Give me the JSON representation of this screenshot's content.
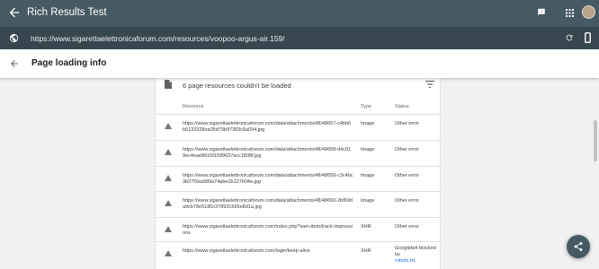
{
  "app": {
    "title": "Rich Results Test"
  },
  "url_bar": {
    "url": "https://www.sigarettaelettronicaforum.com/resources/voopoo-argus-air.159/"
  },
  "page": {
    "title": "Page loading info"
  },
  "resources": {
    "heading": "6 page resources couldn't be loaded",
    "columns": {
      "resource": "Resource",
      "type": "Type",
      "status": "Status"
    },
    "rows": [
      {
        "resource": "https://www.sigarettaelettronicaforum.com/data/attachments/48/48657-c4bb6b5133328ea05d79b97383c6a094.jpg",
        "type": "Image",
        "status": "Other error"
      },
      {
        "resource": "https://www.sigarettaelettronicaforum.com/data/attachments/48/48658-d4c019ec4eae8916f1599637acc1838f.jpg",
        "type": "Image",
        "status": "Other error"
      },
      {
        "resource": "https://www.sigarettaelettronicaforum.com/data/attachments/48/48659-c3c4bc3b27f2ea989a74abe2b127b04e.jpg",
        "type": "Image",
        "status": "Other error"
      },
      {
        "resource": "https://www.sigarettaelettronicaforum.com/data/attachments/48/48660-2bf69da9cb78e5180c378931655e8d1a.jpg",
        "type": "Image",
        "status": "Other error"
      },
      {
        "resource": "https://www.sigarettaelettronicaforum.com/index.php?sam-item/track-impressions",
        "type": "XHR",
        "status": "Other error"
      },
      {
        "resource": "https://www.sigarettaelettronicaforum.com/login/keep-alive",
        "type": "XHR",
        "status": "Googlebot blocked by",
        "status_link": "robots.txt"
      }
    ]
  },
  "colors": {
    "topbar": "#455a64",
    "urlbar": "#37474f",
    "link": "#1a73e8",
    "warning_icon": "#757575"
  },
  "icons": {
    "back": "arrow-back-icon",
    "feedback": "feedback-icon",
    "apps": "apps-grid-icon",
    "globe": "globe-icon",
    "refresh": "refresh-icon",
    "device": "smartphone-icon",
    "document": "document-icon",
    "filter": "filter-icon",
    "warning": "warning-triangle-icon",
    "share": "share-icon"
  }
}
